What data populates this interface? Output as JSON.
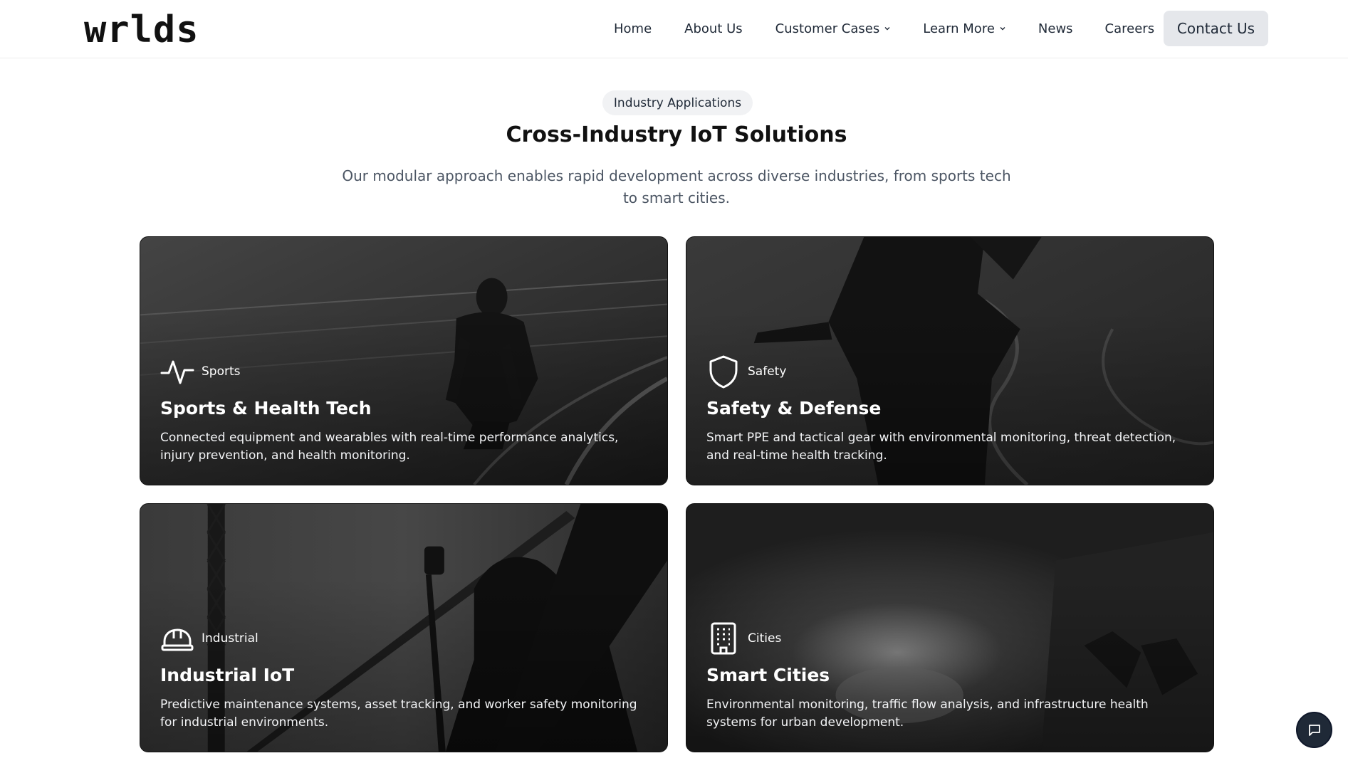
{
  "header": {
    "logo": "wrlds",
    "nav": [
      {
        "label": "Home"
      },
      {
        "label": "About Us"
      },
      {
        "label": "Customer Cases"
      },
      {
        "label": "Learn More"
      },
      {
        "label": "News"
      },
      {
        "label": "Careers"
      }
    ],
    "contact_label": "Contact Us"
  },
  "section": {
    "badge": "Industry Applications",
    "title": "Cross-Industry IoT Solutions",
    "subtitle": "Our modular approach enables rapid development across diverse industries, from sports tech to smart cities."
  },
  "cards": [
    {
      "tag": "Sports",
      "icon": "activity-icon",
      "title": "Sports & Health Tech",
      "description": "Connected equipment and wearables with real-time performance analytics, injury prevention, and health monitoring."
    },
    {
      "tag": "Safety",
      "icon": "shield-icon",
      "title": "Safety & Defense",
      "description": "Smart PPE and tactical gear with environmental monitoring, threat detection, and real-time health tracking."
    },
    {
      "tag": "Industrial",
      "icon": "hard-hat-icon",
      "title": "Industrial IoT",
      "description": "Predictive maintenance systems, asset tracking, and worker safety monitoring for industrial environments."
    },
    {
      "tag": "Cities",
      "icon": "building-icon",
      "title": "Smart Cities",
      "description": "Environmental monitoring, traffic flow analysis, and infrastructure health systems for urban development."
    }
  ],
  "chat": {
    "icon": "chat-bubble-icon"
  }
}
